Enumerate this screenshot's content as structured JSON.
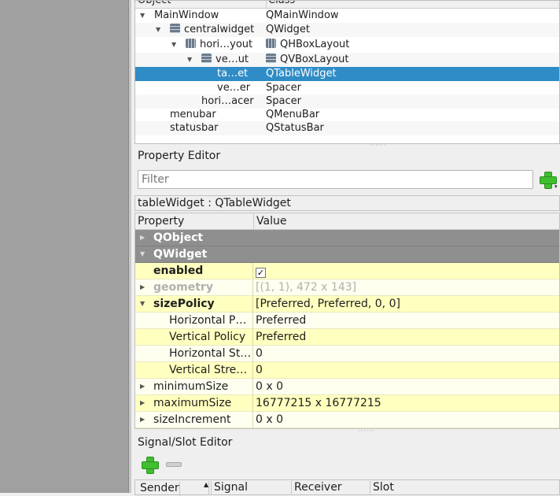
{
  "object_inspector": {
    "columns": [
      "Object",
      "Class"
    ],
    "rows": [
      {
        "name": "MainWindow",
        "class": "QMainWindow",
        "expanded": true
      },
      {
        "name": "centralwidget",
        "class": "QWidget",
        "expanded": true,
        "icon": "vbox-layout-icon"
      },
      {
        "name": "hori…yout",
        "class": "QHBoxLayout",
        "expanded": true,
        "icon": "hbox-layout-icon"
      },
      {
        "name": "ve…ut",
        "class": "QVBoxLayout",
        "expanded": true,
        "icon": "vbox-layout-icon"
      },
      {
        "name": "ta…et",
        "class": "QTableWidget",
        "selected": true
      },
      {
        "name": "ve…er",
        "class": "Spacer"
      },
      {
        "name": "hori…acer",
        "class": "Spacer"
      },
      {
        "name": "menubar",
        "class": "QMenuBar"
      },
      {
        "name": "statusbar",
        "class": "QStatusBar"
      }
    ]
  },
  "property_editor": {
    "title": "Property Editor",
    "filter_placeholder": "Filter",
    "object_label": "tableWidget : QTableWidget",
    "columns": [
      "Property",
      "Value"
    ],
    "rows": [
      {
        "property": "QObject",
        "value": ""
      },
      {
        "property": "QWidget",
        "value": ""
      },
      {
        "property": "enabled",
        "value": "✓"
      },
      {
        "property": "geometry",
        "value": "[(1, 1), 472 x 143]"
      },
      {
        "property": "sizePolicy",
        "value": "[Preferred, Preferred, 0, 0]"
      },
      {
        "property": "Horizontal P…",
        "value": "Preferred"
      },
      {
        "property": "Vertical Policy",
        "value": "Preferred"
      },
      {
        "property": "Horizontal St…",
        "value": "0"
      },
      {
        "property": "Vertical Stre…",
        "value": "0"
      },
      {
        "property": "minimumSize",
        "value": "0 x 0"
      },
      {
        "property": "maximumSize",
        "value": "16777215 x 16777215"
      },
      {
        "property": "sizeIncrement",
        "value": "0 x 0"
      }
    ]
  },
  "signal_slot_editor": {
    "title": "Signal/Slot Editor",
    "columns": [
      "Sender",
      "Signal",
      "Receiver",
      "Slot"
    ]
  }
}
